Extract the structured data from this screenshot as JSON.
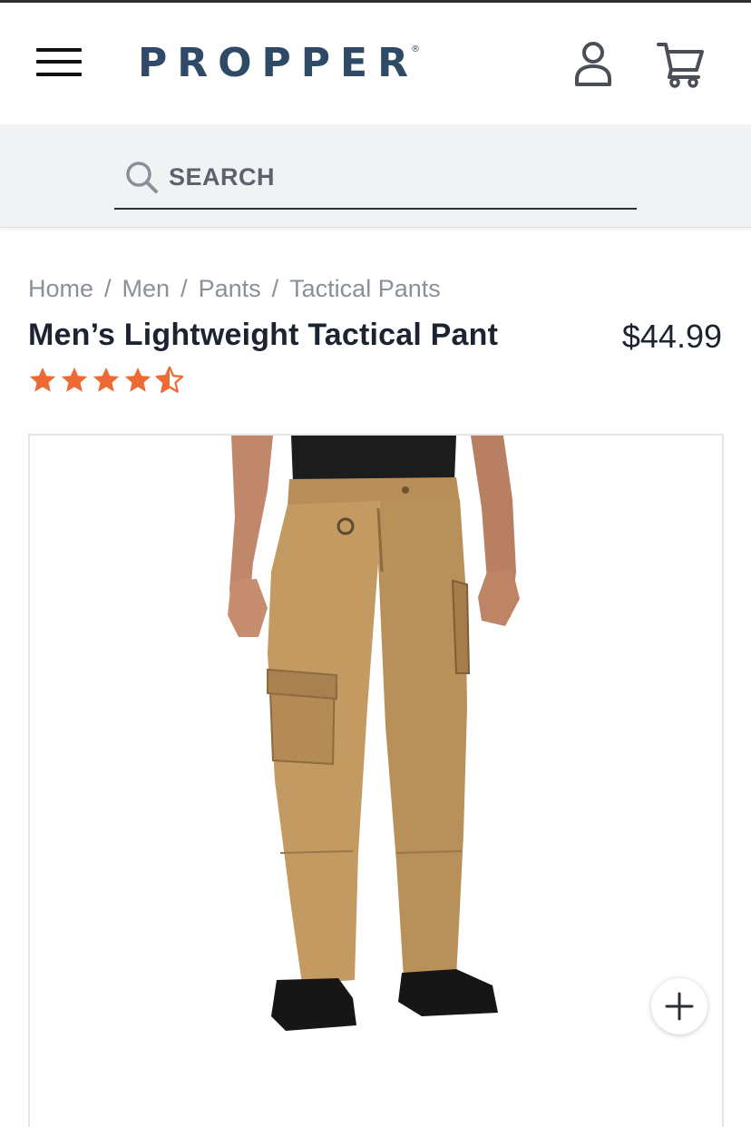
{
  "header": {
    "brand": "PROPPER",
    "brand_mark": "®",
    "icons": [
      "menu-icon",
      "user-icon",
      "cart-icon"
    ]
  },
  "search": {
    "placeholder": "SEARCH",
    "value": ""
  },
  "breadcrumb": [
    {
      "label": "Home"
    },
    {
      "label": "Men"
    },
    {
      "label": "Pants"
    },
    {
      "label": "Tactical Pants"
    }
  ],
  "breadcrumb_separator": "/",
  "product": {
    "title": "Men’s Lightweight Tactical Pant",
    "price": "$44.99",
    "rating": 4.5,
    "rating_max": 5,
    "image_alt": "Men's lightweight tactical pant in coyote tan"
  },
  "colors": {
    "brand": "#2e4a66",
    "star": "#ee6a35",
    "pant": "#c39a62",
    "text": "#1c2431",
    "muted": "#8a9099"
  }
}
